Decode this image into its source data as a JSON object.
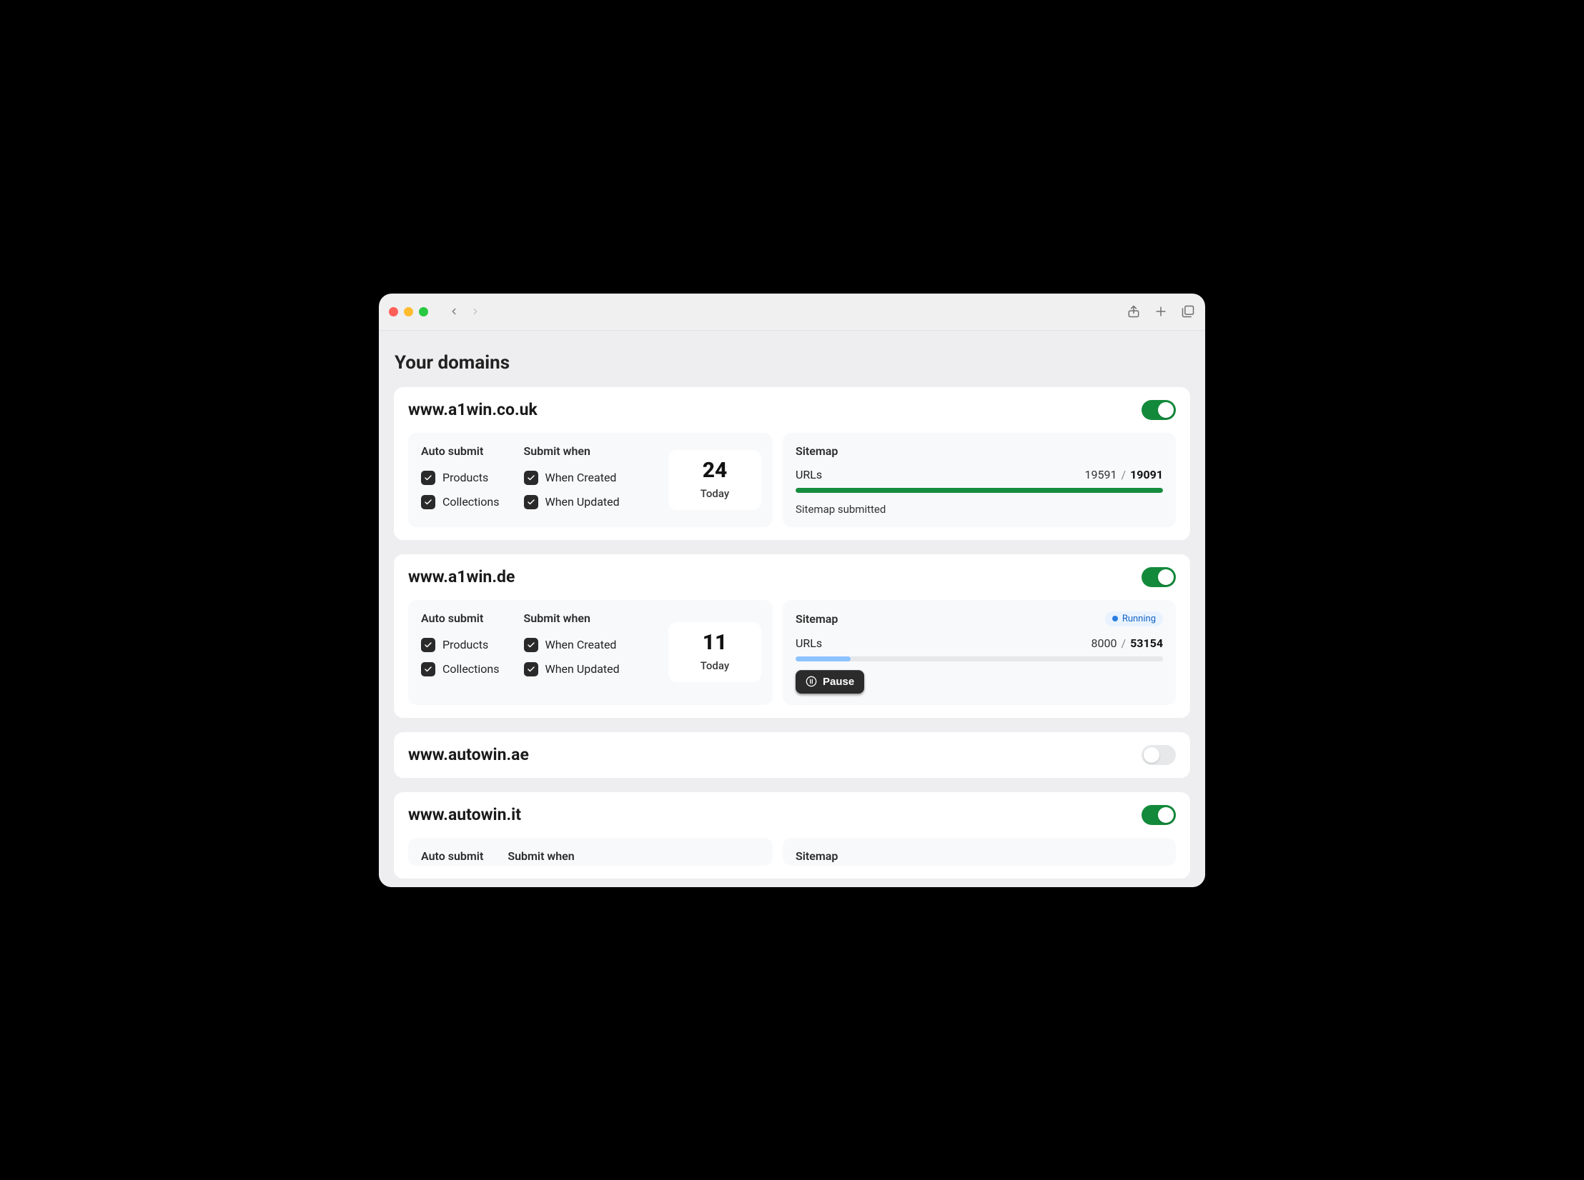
{
  "page": {
    "title": "Your domains"
  },
  "domains": [
    {
      "name": "www.a1win.co.uk",
      "enabled": true,
      "expanded": true,
      "auto_submit_hdr": "Auto submit",
      "submit_when_hdr": "Submit when",
      "products_label": "Products",
      "collections_label": "Collections",
      "when_created_label": "When Created",
      "when_updated_label": "When Updated",
      "count": "24",
      "count_label": "Today",
      "sitemap_hdr": "Sitemap",
      "urls_label": "URLs",
      "urls_done": "19591",
      "urls_total": "19091",
      "status_text": "Sitemap submitted",
      "progress_pct": 100,
      "progress_color": "green",
      "has_badge": false,
      "has_pause": false
    },
    {
      "name": "www.a1win.de",
      "enabled": true,
      "expanded": true,
      "auto_submit_hdr": "Auto submit",
      "submit_when_hdr": "Submit when",
      "products_label": "Products",
      "collections_label": "Collections",
      "when_created_label": "When Created",
      "when_updated_label": "When Updated",
      "count": "11",
      "count_label": "Today",
      "sitemap_hdr": "Sitemap",
      "urls_label": "URLs",
      "urls_done": "8000",
      "urls_total": "53154",
      "badge_text": "Running",
      "pause_label": "Pause",
      "progress_pct": 15,
      "progress_color": "blue",
      "has_badge": true,
      "has_pause": true
    },
    {
      "name": "www.autowin.ae",
      "enabled": false,
      "expanded": false
    },
    {
      "name": "www.autowin.it",
      "enabled": true,
      "expanded": true,
      "partial": true,
      "auto_submit_hdr": "Auto submit",
      "submit_when_hdr": "Submit when",
      "sitemap_hdr": "Sitemap"
    }
  ]
}
